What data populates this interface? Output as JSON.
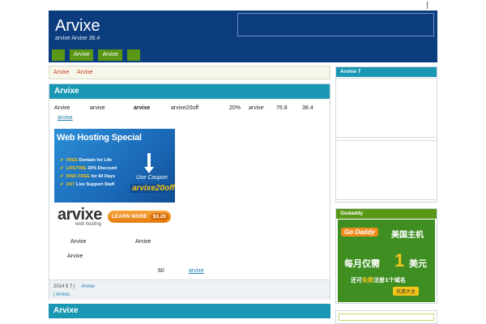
{
  "header": {
    "site_title": "Arvixe",
    "tagline": "arvixe        Arvixe    38.4",
    "nav": [
      "",
      "Arvixe",
      "Arvixe",
      ""
    ]
  },
  "breadcrumb": [
    "Arvixe",
    "Arvixe"
  ],
  "post": {
    "title": "Arvixe",
    "row1": {
      "a": "Arvixe",
      "b": "arvixe",
      "c": "arvixe",
      "d": "arvixe20off",
      "e": "20%",
      "f": "arvixe",
      "g": "76.8",
      "h": "38.4"
    },
    "link1": "arvixe",
    "banner": {
      "title": "Web Hosting Special",
      "items": [
        {
          "em": "FREE",
          "text": " Domain for Life"
        },
        {
          "em": "LIFETIME",
          "text": " 20% Discount"
        },
        {
          "em": "RISK FREE",
          "text": " for 60 Days"
        },
        {
          "em": "24/7",
          "text": " Live Support Staff"
        }
      ],
      "coupon_label": "Use Coupon",
      "coupon_code": "arvixe20off"
    },
    "logo": {
      "name": "arvixe",
      "sub": "web hosting"
    },
    "learn_more": {
      "label": "LEARN MORE",
      "price": "$3.20"
    },
    "text_a": "Arvixe",
    "text_b": "Arvixe",
    "text_c": "Arvixe",
    "text_d": "60",
    "link2": "arvixe",
    "meta_date": "2014 9 7  |",
    "meta_cat": "Arvixe",
    "meta_tags": "| Arvixe,"
  },
  "post2": {
    "title": "Arvixe"
  },
  "sidebar": {
    "widget1_title": "Arvixe    7",
    "widget2_title": "Godaddy",
    "godaddy": {
      "logo": "Go Daddy",
      "headline": "美国主机",
      "line2a": "每月仅需",
      "big": "1",
      "line2b": "美元",
      "line3a": "还可",
      "line3em": "免费",
      "line3b": "注册1个域名",
      "btn": "优惠大全"
    }
  }
}
